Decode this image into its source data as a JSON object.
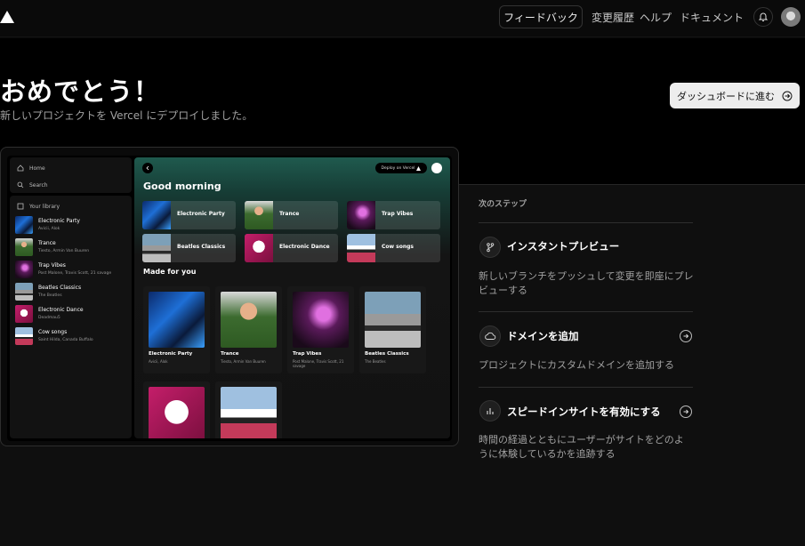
{
  "topbar": {
    "feedback": "フィードバック",
    "changelog": "変更履歴",
    "help": "ヘルプ",
    "docs": "ドキュメント"
  },
  "hero": {
    "title": "おめでとう！",
    "subtitle": "新しいプロジェクトを Vercel にデプロイしました。",
    "dashboard_button": "ダッシュボードに進む"
  },
  "preview": {
    "sidebar": {
      "home": "Home",
      "search": "Search",
      "library_label": "Your library",
      "items": [
        {
          "name": "Electronic Party",
          "sub": "Avicii, Alok",
          "art": "art-ep"
        },
        {
          "name": "Trance",
          "sub": "Tiesto, Armin Van Buuren",
          "art": "art-tr"
        },
        {
          "name": "Trap Vibes",
          "sub": "Post Malone, Travis Scott, 21 savage",
          "art": "art-tv"
        },
        {
          "name": "Beatles Classics",
          "sub": "The Beatles",
          "art": "art-bc"
        },
        {
          "name": "Electronic Dance",
          "sub": "Deadmau5",
          "art": "art-ed"
        },
        {
          "name": "Cow songs",
          "sub": "Saint Hilda, Canada Buffalo",
          "art": "art-cs"
        }
      ]
    },
    "main": {
      "deploy_label": "Deploy on Vercel",
      "greeting": "Good morning",
      "tiles": [
        {
          "name": "Electronic Party",
          "art": "art-ep"
        },
        {
          "name": "Trance",
          "art": "art-tr"
        },
        {
          "name": "Trap Vibes",
          "art": "art-tv"
        },
        {
          "name": "Beatles Classics",
          "art": "art-bc"
        },
        {
          "name": "Electronic Dance",
          "art": "art-ed"
        },
        {
          "name": "Cow songs",
          "art": "art-cs"
        }
      ],
      "made_for_you": "Made for you",
      "cards": [
        {
          "name": "Electronic Party",
          "sub": "Avicii, Alok",
          "art": "art-ep"
        },
        {
          "name": "Trance",
          "sub": "Tiesto, Armin Van Buuren",
          "art": "art-tr"
        },
        {
          "name": "Trap Vibes",
          "sub": "Post Malone, Travis Scott, 21 savage",
          "art": "art-tv"
        },
        {
          "name": "Beatles Classics",
          "sub": "The Beatles",
          "art": "art-bc"
        }
      ],
      "cards_row2": [
        {
          "art": "art-ed"
        },
        {
          "art": "art-cs"
        }
      ]
    }
  },
  "next_steps": {
    "heading": "次のステップ",
    "steps": [
      {
        "title": "インスタントプレビュー",
        "desc": "新しいブランチをプッシュして変更を即座にプレビューする",
        "icon": "branch-icon"
      },
      {
        "title": "ドメインを追加",
        "desc": "プロジェクトにカスタムドメインを追加する",
        "icon": "cloud-icon"
      },
      {
        "title": "スピードインサイトを有効にする",
        "desc": "時間の経過とともにユーザーがサイトをどのように体験しているかを追跡する",
        "icon": "bar-chart-icon"
      }
    ]
  }
}
